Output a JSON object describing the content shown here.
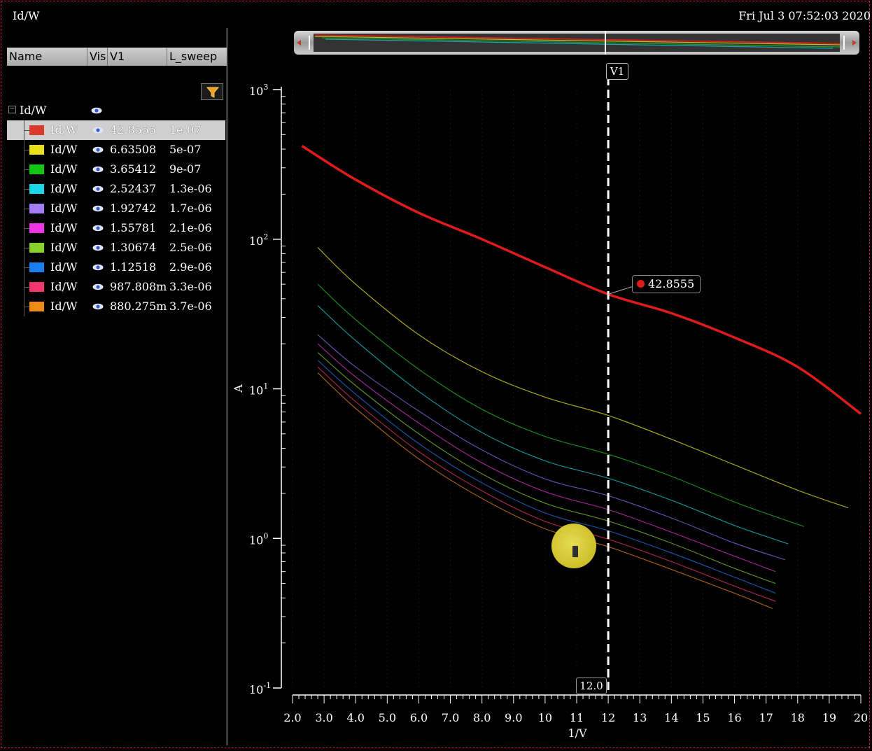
{
  "window": {
    "title": "Id/W",
    "timestamp": "Fri Jul  3 07:52:03 2020"
  },
  "browser": {
    "columns": [
      "Name",
      "Vis",
      "V1",
      "L_sweep"
    ],
    "root": {
      "label": "Id/W"
    },
    "rows": [
      {
        "name": "Id/W",
        "color": "#d93a2e",
        "v1": "42.8555",
        "l_sweep": "1e-07",
        "selected": true
      },
      {
        "name": "Id/W",
        "color": "#e8e01a",
        "v1": "6.63508",
        "l_sweep": "5e-07"
      },
      {
        "name": "Id/W",
        "color": "#12c712",
        "v1": "3.65412",
        "l_sweep": "9e-07"
      },
      {
        "name": "Id/W",
        "color": "#19d6e6",
        "v1": "2.52437",
        "l_sweep": "1.3e-06"
      },
      {
        "name": "Id/W",
        "color": "#a47cf5",
        "v1": "1.92742",
        "l_sweep": "1.7e-06"
      },
      {
        "name": "Id/W",
        "color": "#ef35e3",
        "v1": "1.55781",
        "l_sweep": "2.1e-06"
      },
      {
        "name": "Id/W",
        "color": "#86d12a",
        "v1": "1.30674",
        "l_sweep": "2.5e-06"
      },
      {
        "name": "Id/W",
        "color": "#1a7df0",
        "v1": "1.12518",
        "l_sweep": "2.9e-06"
      },
      {
        "name": "Id/W",
        "color": "#f0356f",
        "v1": "987.808m",
        "l_sweep": "3.3e-06"
      },
      {
        "name": "Id/W",
        "color": "#ef8a17",
        "v1": "880.275m",
        "l_sweep": "3.7e-06"
      }
    ]
  },
  "cursor": {
    "name": "V1",
    "x_label": "12.0",
    "x": 12,
    "readout": "42.8555"
  },
  "chart_data": {
    "type": "line",
    "xlabel": "1/V",
    "ylabel": "A",
    "xlim": [
      2.0,
      20.0
    ],
    "ylim_log10": [
      -1,
      3
    ],
    "yscale": "log",
    "x_ticks": [
      "2.0",
      "3.0",
      "4.0",
      "5.0",
      "6.0",
      "7.0",
      "8.0",
      "9.0",
      "10",
      "11",
      "12",
      "13",
      "14",
      "15",
      "16",
      "17",
      "18",
      "19",
      "20"
    ],
    "y_ticks": [
      {
        "base": "10",
        "exp": "3",
        "value": 1000
      },
      {
        "base": "10",
        "exp": "2",
        "value": 100
      },
      {
        "base": "10",
        "exp": "1",
        "value": 10
      },
      {
        "base": "10",
        "exp": "0",
        "value": 1
      },
      {
        "base": "10",
        "exp": "-1",
        "value": 0.1
      }
    ],
    "series": [
      {
        "color": "#e01b1b",
        "points": [
          [
            2.3,
            420
          ],
          [
            4,
            250
          ],
          [
            6,
            150
          ],
          [
            8,
            100
          ],
          [
            10,
            65
          ],
          [
            12,
            42.8555
          ],
          [
            14,
            32
          ],
          [
            16,
            22
          ],
          [
            18,
            14
          ],
          [
            20,
            6.8
          ]
        ]
      },
      {
        "color": "#c9c020",
        "points": [
          [
            2.8,
            88
          ],
          [
            4,
            50
          ],
          [
            6,
            23
          ],
          [
            8,
            13
          ],
          [
            10,
            8.8
          ],
          [
            12,
            6.63508
          ],
          [
            14,
            4.6
          ],
          [
            16,
            3.1
          ],
          [
            18,
            2.1
          ],
          [
            19.6,
            1.6
          ]
        ]
      },
      {
        "color": "#1fa01f",
        "points": [
          [
            2.8,
            50
          ],
          [
            4,
            29
          ],
          [
            6,
            13.5
          ],
          [
            8,
            7.3
          ],
          [
            10,
            4.8
          ],
          [
            12,
            3.65412
          ],
          [
            14,
            2.6
          ],
          [
            16,
            1.75
          ],
          [
            18.2,
            1.2
          ]
        ]
      },
      {
        "color": "#18a8b4",
        "points": [
          [
            2.8,
            36
          ],
          [
            4,
            21
          ],
          [
            6,
            9.6
          ],
          [
            8,
            5.1
          ],
          [
            10,
            3.3
          ],
          [
            12,
            2.52437
          ],
          [
            14,
            1.8
          ],
          [
            16,
            1.22
          ],
          [
            17.7,
            0.92
          ]
        ]
      },
      {
        "color": "#7a5bc4",
        "points": [
          [
            2.8,
            23
          ],
          [
            4,
            14
          ],
          [
            6,
            7.1
          ],
          [
            8,
            3.9
          ],
          [
            10,
            2.5
          ],
          [
            12,
            1.92742
          ],
          [
            14,
            1.37
          ],
          [
            16,
            0.93
          ],
          [
            17.6,
            0.72
          ]
        ]
      },
      {
        "color": "#b42aa9",
        "points": [
          [
            2.8,
            20
          ],
          [
            4,
            12
          ],
          [
            6,
            5.9
          ],
          [
            8,
            3.2
          ],
          [
            10,
            2.05
          ],
          [
            12,
            1.55781
          ],
          [
            14,
            1.1
          ],
          [
            16,
            0.76
          ],
          [
            17.3,
            0.6
          ]
        ]
      },
      {
        "color": "#6aa722",
        "points": [
          [
            2.8,
            17.5
          ],
          [
            4,
            10.5
          ],
          [
            6,
            5.0
          ],
          [
            8,
            2.7
          ],
          [
            10,
            1.72
          ],
          [
            12,
            1.30674
          ],
          [
            14,
            0.93
          ],
          [
            16,
            0.63
          ],
          [
            17.3,
            0.5
          ]
        ]
      },
      {
        "color": "#1a5fc0",
        "points": [
          [
            2.8,
            15.5
          ],
          [
            4,
            9.2
          ],
          [
            6,
            4.3
          ],
          [
            8,
            2.35
          ],
          [
            10,
            1.48
          ],
          [
            12,
            1.12518
          ],
          [
            14,
            0.8
          ],
          [
            16,
            0.55
          ],
          [
            17.3,
            0.43
          ]
        ]
      },
      {
        "color": "#c02b59",
        "points": [
          [
            2.8,
            14
          ],
          [
            4,
            8.2
          ],
          [
            6,
            3.8
          ],
          [
            8,
            2.08
          ],
          [
            10,
            1.3
          ],
          [
            12,
            0.987808
          ],
          [
            14,
            0.7
          ],
          [
            16,
            0.48
          ],
          [
            17.3,
            0.38
          ]
        ]
      },
      {
        "color": "#c26d12",
        "points": [
          [
            2.8,
            12.8
          ],
          [
            4,
            7.4
          ],
          [
            6,
            3.4
          ],
          [
            8,
            1.85
          ],
          [
            10,
            1.16
          ],
          [
            12,
            0.880275
          ],
          [
            14,
            0.62
          ],
          [
            16,
            0.43
          ],
          [
            17.2,
            0.34
          ]
        ]
      }
    ]
  }
}
